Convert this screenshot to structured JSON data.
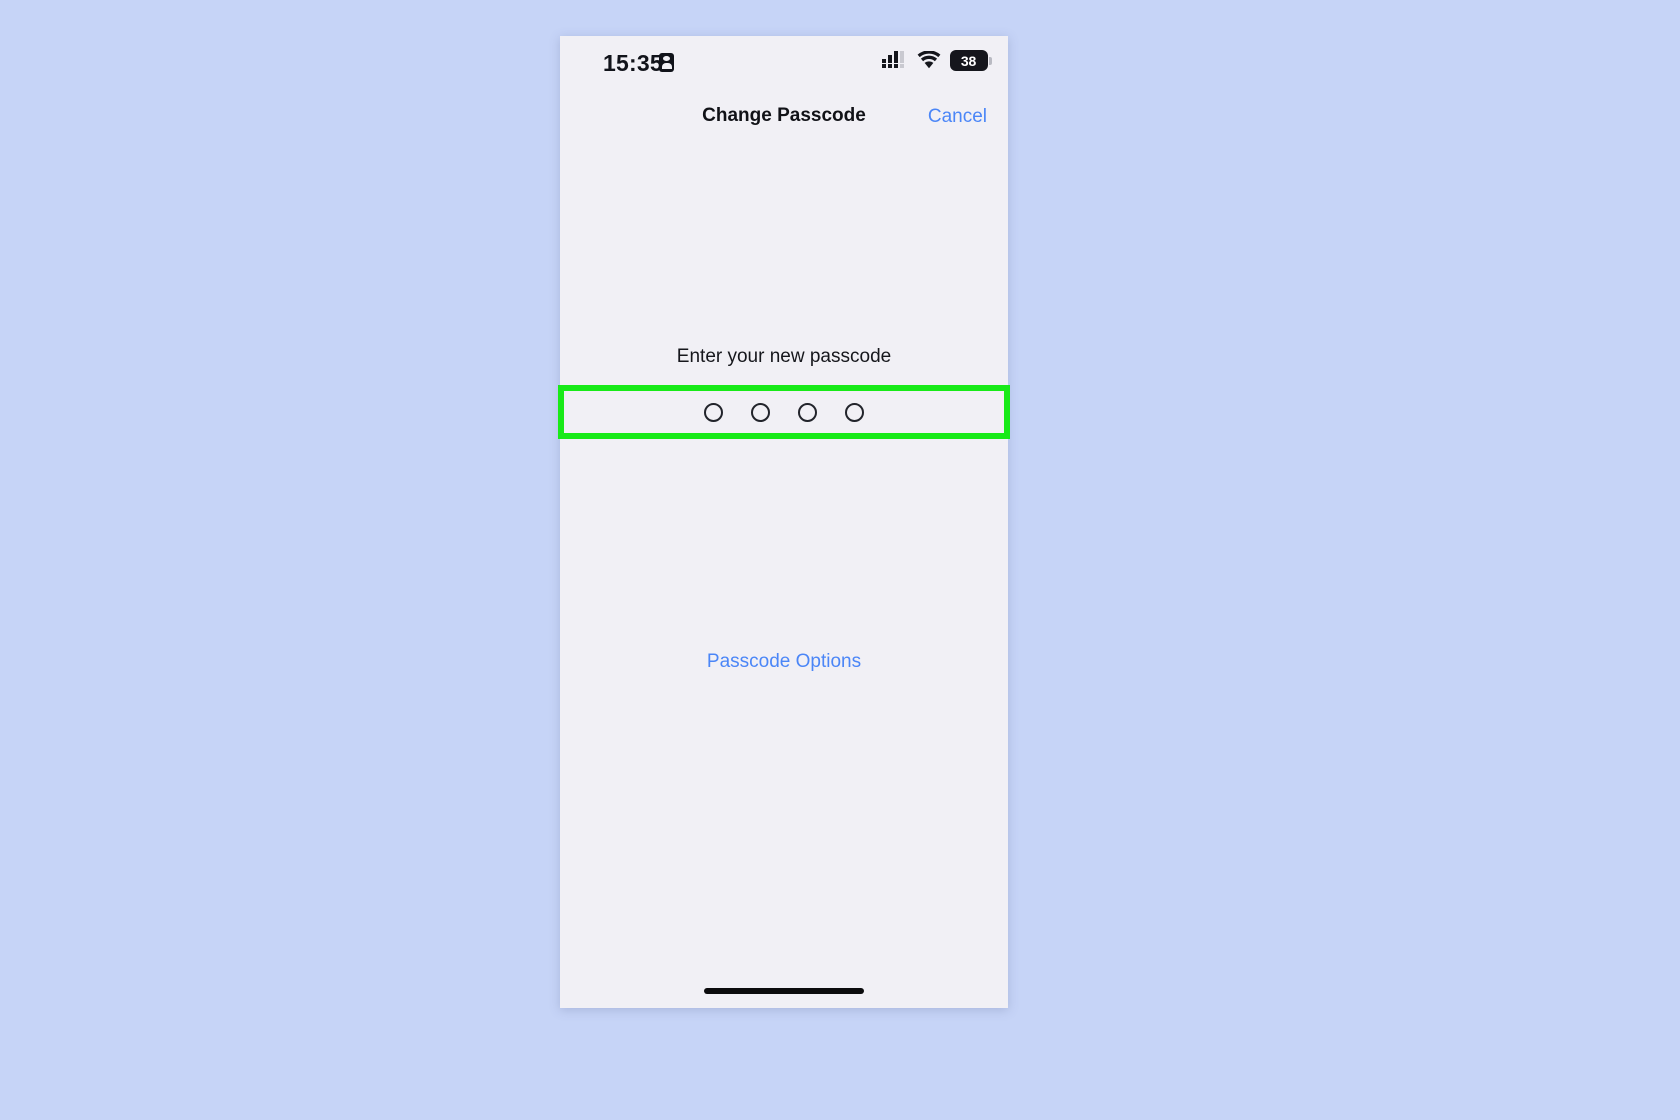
{
  "page": {
    "background_color": "#c6d4f7",
    "device_screen_color": "#f1f0f5"
  },
  "status_bar": {
    "time": "15:35",
    "time_icon": "recording-indicator-icon",
    "cellular_icon": "cellular-signal-icon",
    "wifi_icon": "wifi-icon",
    "battery": {
      "level_text": "38",
      "icon": "battery-icon"
    }
  },
  "nav_bar": {
    "title": "Change Passcode",
    "cancel_label": "Cancel",
    "cancel_color": "#4b86f7"
  },
  "main": {
    "prompt": "Enter your new passcode",
    "passcode_dots": {
      "count": 4,
      "filled": 0,
      "states": [
        "empty",
        "empty",
        "empty",
        "empty"
      ]
    },
    "passcode_options_label": "Passcode Options",
    "passcode_options_color": "#4b86f7"
  },
  "annotation": {
    "highlight_color": "#18ea18",
    "target": "passcode-dots-row"
  },
  "home_indicator": {
    "color": "#0b0b0d"
  }
}
